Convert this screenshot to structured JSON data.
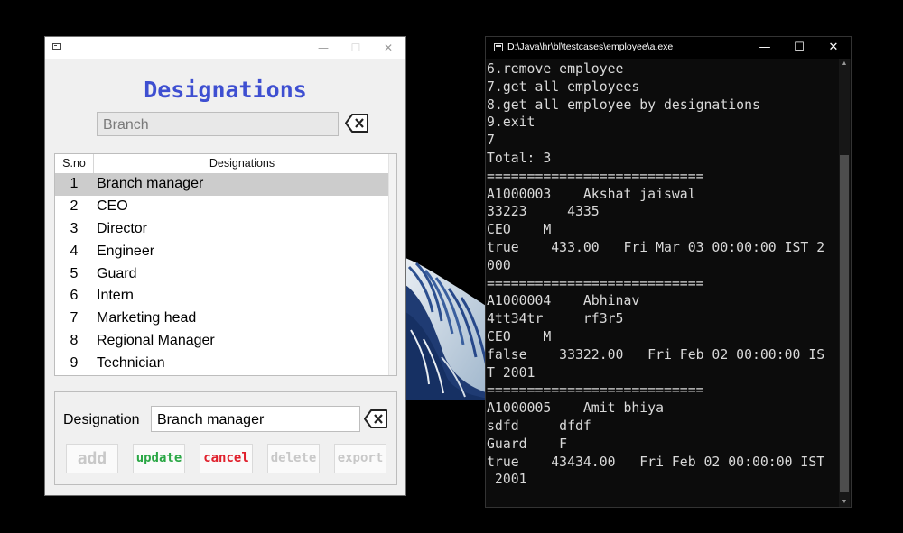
{
  "designations_window": {
    "heading": "Designations",
    "search_placeholder": "Branch",
    "columns": [
      "S.no",
      "Designations"
    ],
    "rows": [
      {
        "sno": "1",
        "name": "Branch manager"
      },
      {
        "sno": "2",
        "name": "CEO"
      },
      {
        "sno": "3",
        "name": "Director"
      },
      {
        "sno": "4",
        "name": "Engineer"
      },
      {
        "sno": "5",
        "name": "Guard"
      },
      {
        "sno": "6",
        "name": "Intern"
      },
      {
        "sno": "7",
        "name": "Marketing head"
      },
      {
        "sno": "8",
        "name": "Regional Manager"
      },
      {
        "sno": "9",
        "name": "Technician"
      }
    ],
    "selected_row": 0,
    "designation_label": "Designation",
    "designation_value": "Branch manager",
    "buttons": {
      "add": {
        "label": "add",
        "color": "#c8c8c8",
        "enabled": false
      },
      "update": {
        "label": "update",
        "color": "#2aa745",
        "enabled": true
      },
      "cancel": {
        "label": "cancel",
        "color": "#e0202c",
        "enabled": true
      },
      "delete": {
        "label": "delete",
        "color": "#c8c8c8",
        "enabled": false
      },
      "export": {
        "label": "export",
        "color": "#c8c8c8",
        "enabled": false
      }
    },
    "accent_color": "#3e4fd1"
  },
  "console_window": {
    "title": "D:\\Java\\hr\\bl\\testcases\\employee\\a.exe",
    "controls": {
      "minimize": "—",
      "maximize": "☐",
      "close": "✕"
    },
    "lines": [
      "6.remove employee",
      "7.get all employees",
      "8.get all employee by designations",
      "9.exit",
      "7",
      "Total: 3",
      "===========================",
      "A1000003    Akshat jaiswal",
      "33223     4335",
      "CEO    M",
      "true    433.00   Fri Mar 03 00:00:00 IST 2",
      "000",
      "===========================",
      "A1000004    Abhinav",
      "4tt34tr     rf3r5",
      "CEO    M",
      "false    33322.00   Fri Feb 02 00:00:00 IS",
      "T 2001",
      "===========================",
      "A1000005    Amit bhiya",
      "sdfd     dfdf",
      "Guard    F",
      "true    43434.00   Fri Feb 02 00:00:00 IST",
      " 2001"
    ]
  }
}
